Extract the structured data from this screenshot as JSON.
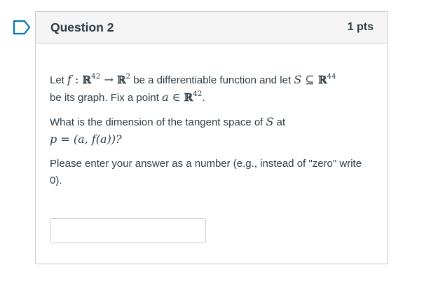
{
  "question": {
    "title": "Question 2",
    "points": "1 pts",
    "flag_icon": "bookmark-flag-icon",
    "accent_color": "#0374b5",
    "body": {
      "p1": {
        "t1": "Let ",
        "f": "f",
        "colon": " : ",
        "R1": "ℝ",
        "exp1": "42",
        "arrow": " → ",
        "R2": "ℝ",
        "exp2": "2",
        "t2": " be a differentiable function and let ",
        "S": "S",
        "subset": " ⊆ ",
        "R3": "ℝ",
        "exp3": "44",
        "t3": "be its graph. Fix a point ",
        "a": "a",
        "in": " ∈ ",
        "R4": "ℝ",
        "exp4": "42",
        "period": "."
      },
      "p2": {
        "t1": "What is the dimension of the tangent space of ",
        "S": "S",
        "t2": " at",
        "expr": "p = (a, f(a))?"
      },
      "p3": "Please enter your answer as a number (e.g., instead of \"zero\" write 0)."
    },
    "answer": {
      "value": "",
      "placeholder": ""
    }
  }
}
